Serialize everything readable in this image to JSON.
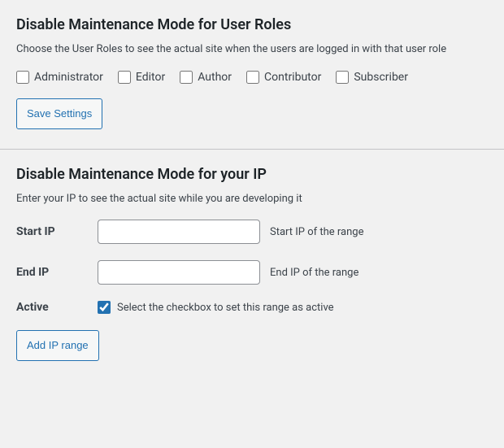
{
  "user_roles_section": {
    "title": "Disable Maintenance Mode for User Roles",
    "description": "Choose the User Roles to see the actual site when the users are logged in with that user role",
    "roles": [
      {
        "id": "administrator",
        "label": "Administrator",
        "checked": false
      },
      {
        "id": "editor",
        "label": "Editor",
        "checked": false
      },
      {
        "id": "author",
        "label": "Author",
        "checked": false
      },
      {
        "id": "contributor",
        "label": "Contributor",
        "checked": false
      },
      {
        "id": "subscriber",
        "label": "Subscriber",
        "checked": false
      }
    ],
    "save_button": "Save Settings"
  },
  "ip_section": {
    "title": "Disable Maintenance Mode for your IP",
    "description": "Enter your IP to see the actual site while you are developing it",
    "start_ip": {
      "label": "Start IP",
      "value": "",
      "hint": "Start IP of the range"
    },
    "end_ip": {
      "label": "End IP",
      "value": "",
      "hint": "End IP of the range"
    },
    "active": {
      "label": "Active",
      "checked": true,
      "description": "Select the checkbox to set this range as active"
    },
    "add_button": "Add IP range"
  }
}
